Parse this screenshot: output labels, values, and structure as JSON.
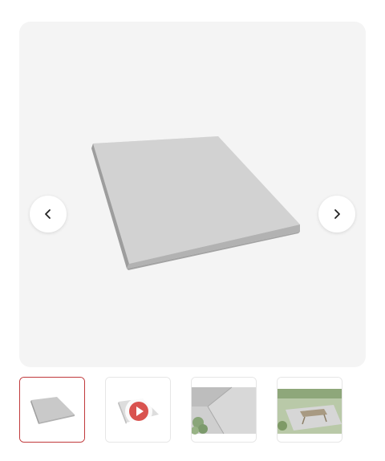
{
  "gallery": {
    "product_image_icon": "concrete-paving-slab",
    "prev_icon": "chevron-left-icon",
    "next_icon": "chevron-right-icon"
  },
  "thumbnails": [
    {
      "subject": "paving-slab",
      "active": true
    },
    {
      "subject": "paving-slab-video",
      "has_play_icon": true
    },
    {
      "subject": "slab-closeup-with-plants"
    },
    {
      "subject": "garden-with-picnic-table"
    }
  ],
  "colors": {
    "active_border": "#c0393b",
    "play_button": "#d9534f"
  }
}
